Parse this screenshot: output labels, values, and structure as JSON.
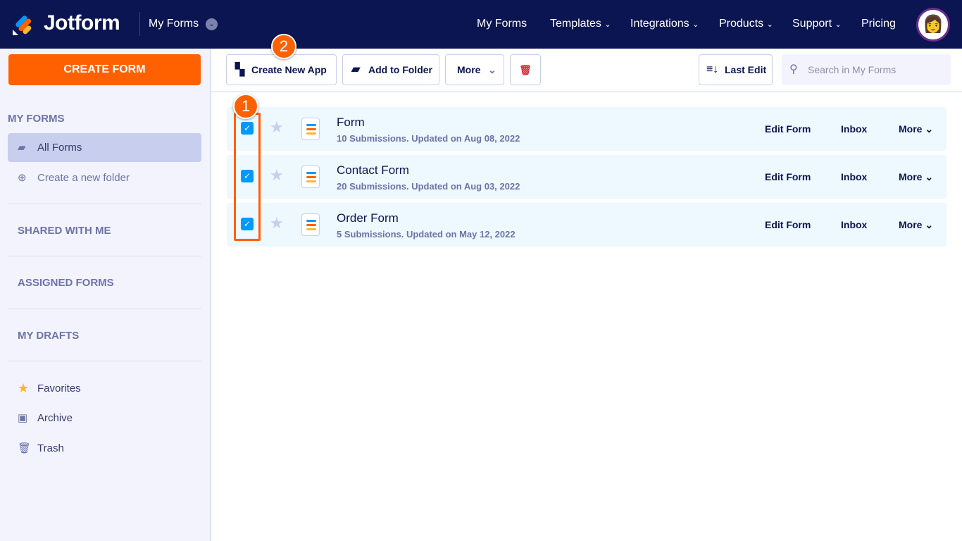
{
  "header": {
    "brand": "Jotform",
    "context": "My Forms",
    "nav": [
      "My Forms",
      "Templates",
      "Integrations",
      "Products",
      "Support",
      "Pricing"
    ]
  },
  "sidebar": {
    "create_label": "CREATE FORM",
    "my_forms": "MY FORMS",
    "all_forms": "All Forms",
    "new_folder": "Create a new folder",
    "shared": "SHARED WITH ME",
    "assigned": "ASSIGNED FORMS",
    "drafts": "MY DRAFTS",
    "favorites": "Favorites",
    "archive": "Archive",
    "trash": "Trash"
  },
  "toolbar": {
    "create_app": "Create New App",
    "add_folder": "Add to Folder",
    "more": "More",
    "sort": "Last Edit",
    "search_placeholder": "Search in My Forms"
  },
  "forms": [
    {
      "title": "Form",
      "meta": "10 Submissions. Updated on Aug 08, 2022",
      "checked": true
    },
    {
      "title": "Contact Form",
      "meta": "20 Submissions. Updated on Aug 03, 2022",
      "checked": true
    },
    {
      "title": "Order Form",
      "meta": "5 Submissions. Updated on May 12, 2022",
      "checked": true
    }
  ],
  "row_actions": {
    "edit": "Edit Form",
    "inbox": "Inbox",
    "more": "More"
  },
  "annotations": {
    "step1": "1",
    "step2": "2"
  }
}
